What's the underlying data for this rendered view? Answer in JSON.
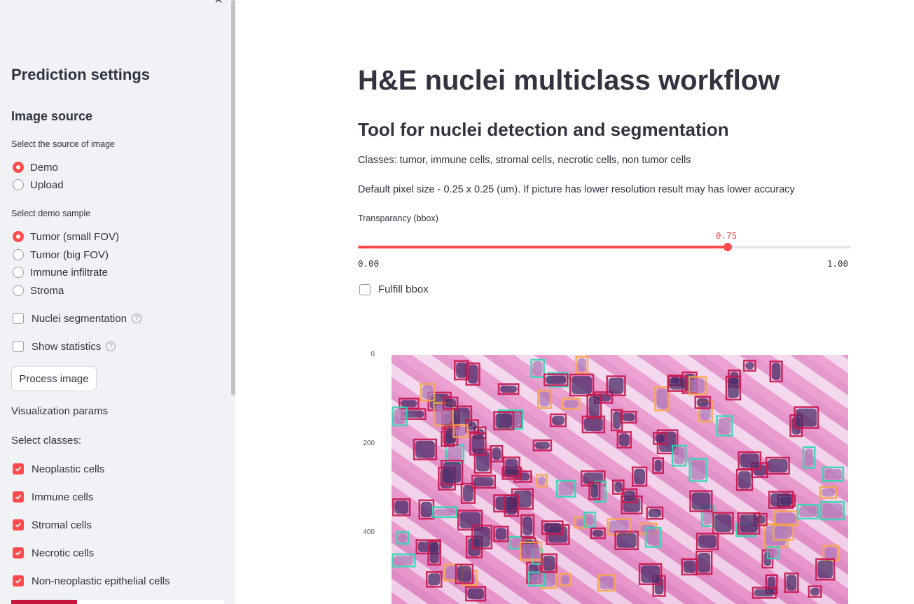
{
  "sidebar": {
    "close_symbol": "×",
    "title": "Prediction settings",
    "image_source_title": "Image source",
    "source_label": "Select the source of image",
    "source_options": [
      "Demo",
      "Upload"
    ],
    "source_selected": "Demo",
    "demo_label": "Select demo sample",
    "demo_options": [
      "Tumor (small FOV)",
      "Tumor (big FOV)",
      "Immune infiltrate",
      "Stroma"
    ],
    "demo_selected": "Tumor (small FOV)",
    "nuclei_segmentation": "Nuclei segmentation",
    "show_statistics": "Show statistics",
    "help_symbol": "?",
    "process_button": "Process image",
    "vis_params": "Visualization params",
    "select_classes": "Select classes:",
    "classes": [
      "Neoplastic cells",
      "Immune cells",
      "Stromal cells",
      "Necrotic cells",
      "Non-neoplastic epithelial cells"
    ]
  },
  "main": {
    "title": "H&E nuclei multiclass workflow",
    "subtitle": "Tool for nuclei detection and segmentation",
    "classes_text": "Classes: tumor, immune cells, stromal cells, necrotic cells, non tumor cells",
    "pixel_text": "Default pixel size - 0.25 x 0.25 (um). If picture has lower resolution result may has lower accuracy",
    "slider_label": "Transparancy (bbox)",
    "slider_value": 0.75,
    "slider_value_text": "0.75",
    "slider_min": "0.00",
    "slider_max": "1.00",
    "fulfill_label": "Fulfill bbox",
    "plot_yticks": [
      "0",
      "200",
      "400"
    ]
  },
  "colors": {
    "accent": "#ff4b4b",
    "neoplastic_box": "#c8164d",
    "stromal_box": "#f5a54a",
    "immune_box": "#2fd6b4"
  },
  "image": {
    "description_icon": "he-stained-tissue-image"
  }
}
